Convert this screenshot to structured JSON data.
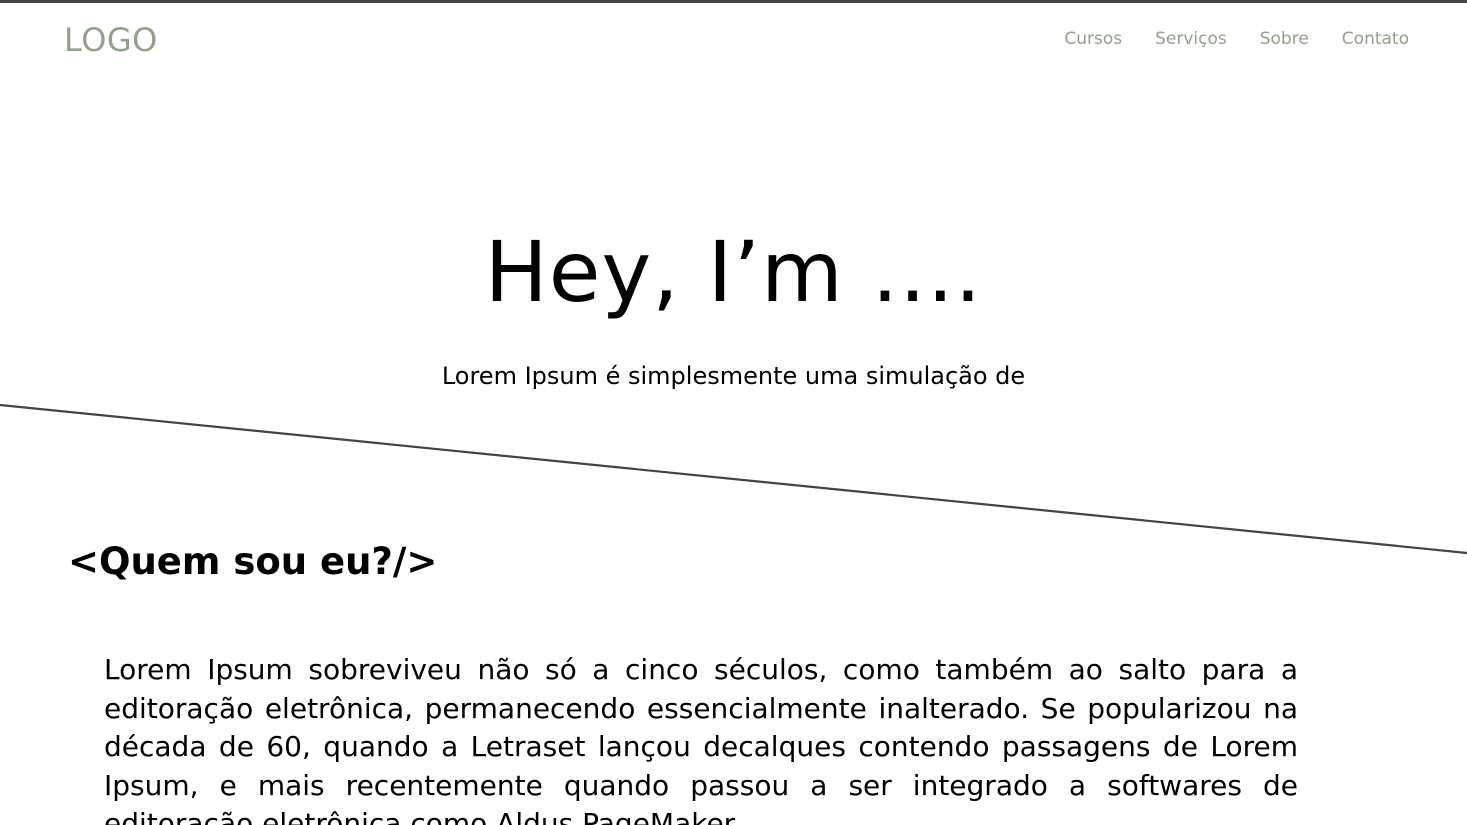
{
  "header": {
    "logo": "LOGO",
    "nav": [
      {
        "label": "Cursos"
      },
      {
        "label": "Serviços"
      },
      {
        "label": "Sobre"
      },
      {
        "label": "Contato"
      }
    ]
  },
  "hero": {
    "title": "Hey, I’m ....",
    "subtitle": "Lorem Ipsum é simplesmente uma simulação de"
  },
  "about": {
    "title": "<Quem sou eu?/>",
    "text": "Lorem Ipsum sobreviveu não só a cinco séculos, como também ao salto para a editoração eletrônica, permanecendo essencialmente inalterado. Se popularizou na década de 60, quando a Letraset lançou decalques contendo passagens de Lorem Ipsum, e mais recentemente quando passou a ser integrado a softwares de editoração eletrônica como Aldus PageMaker."
  },
  "colors": {
    "accent": "#93a08c",
    "border": "#444444",
    "text": "#000000",
    "background": "#ffffff"
  }
}
